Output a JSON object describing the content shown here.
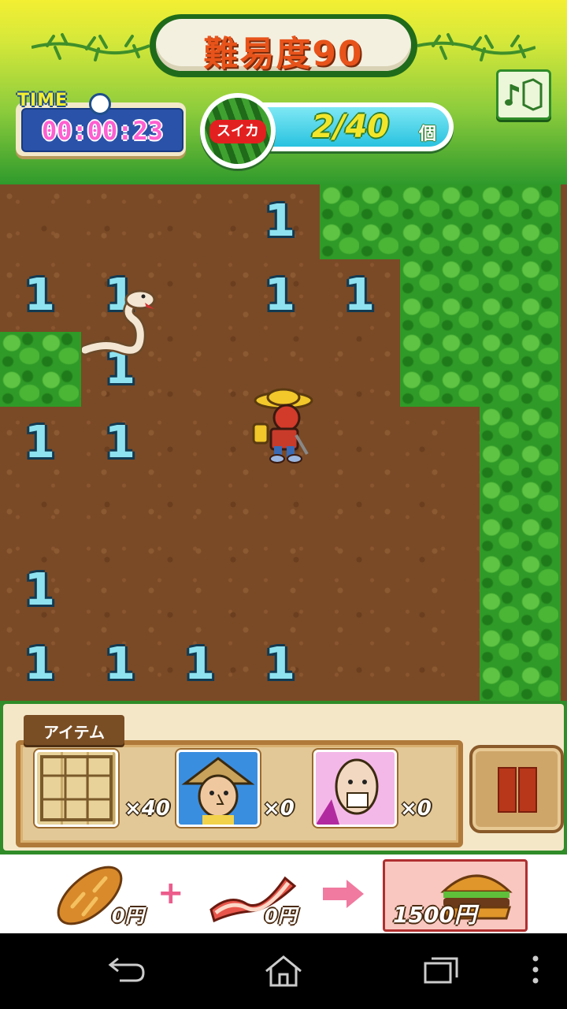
{
  "header": {
    "title": "難易度90",
    "time_label": "TIME",
    "time_value": "00:00:23",
    "watermelon_label": "スイカ",
    "watermelon_count": "2/40",
    "watermelon_unit": "個"
  },
  "field": {
    "numbers": [
      {
        "col": 3,
        "row": 0,
        "value": "1"
      },
      {
        "col": 0,
        "row": 1,
        "value": "1"
      },
      {
        "col": 1,
        "row": 1,
        "value": "1"
      },
      {
        "col": 3,
        "row": 1,
        "value": "1"
      },
      {
        "col": 4,
        "row": 1,
        "value": "1"
      },
      {
        "col": 1,
        "row": 2,
        "value": "1"
      },
      {
        "col": 0,
        "row": 3,
        "value": "1"
      },
      {
        "col": 1,
        "row": 3,
        "value": "1"
      },
      {
        "col": 0,
        "row": 5,
        "value": "1"
      },
      {
        "col": 0,
        "row": 6,
        "value": "1"
      },
      {
        "col": 1,
        "row": 6,
        "value": "1"
      },
      {
        "col": 2,
        "row": 6,
        "value": "1"
      },
      {
        "col": 3,
        "row": 6,
        "value": "1"
      }
    ],
    "grass": [
      [
        4,
        0
      ],
      [
        5,
        0
      ],
      [
        6,
        0
      ],
      [
        5,
        1
      ],
      [
        6,
        1
      ],
      [
        0,
        2
      ],
      [
        5,
        2
      ],
      [
        6,
        2
      ],
      [
        6,
        3
      ],
      [
        6,
        4
      ],
      [
        6,
        5
      ],
      [
        6,
        6
      ]
    ]
  },
  "items": {
    "tab_label": "アイテム",
    "slots": [
      {
        "name": "wooden-board",
        "count": "×40"
      },
      {
        "name": "farmer-portrait",
        "count": "×0"
      },
      {
        "name": "old-man-portrait",
        "count": "×0"
      }
    ]
  },
  "ad": {
    "bread_price": "0円",
    "bacon_price": "0円",
    "burger_price": "1500円"
  }
}
